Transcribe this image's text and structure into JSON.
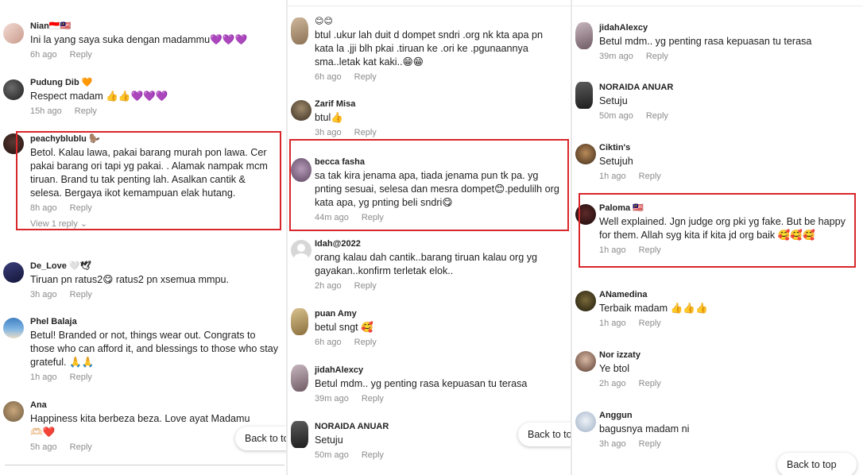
{
  "back_to_top": "Back to top",
  "columns": [
    {
      "comments": [
        {
          "name": "Nian🇮🇩🇲🇾",
          "text": "Ini la yang saya suka dengan madammu💜💜💜",
          "time": "6h ago",
          "reply": "Reply"
        },
        {
          "name": "Pudung Dib 🧡",
          "text": "Respect madam 👍👍💜💜💜",
          "time": "15h ago",
          "reply": "Reply"
        },
        {
          "name": "peachyblublu 🦫",
          "text": "Betol. Kalau lawa, pakai barang murah pon lawa. Cer pakai barang ori tapi yg pakai. . Alamak nampak mcm tiruan. Brand tu tak penting lah. Asalkan cantik & selesa. Bergaya ikot kemampuan elak hutang.",
          "time": "8h ago",
          "reply": "Reply",
          "view_replies": "View 1 reply ⌄"
        },
        {
          "name": "De_Love 🤍🕊",
          "text": "Tiruan pn ratus2😋 ratus2 pn xsemua mmpu.",
          "time": "3h ago",
          "reply": "Reply"
        },
        {
          "name": "Phel Balaja",
          "text": "Betul! Branded or not, things wear out. Congrats to those who can afford it, and blessings to those who stay grateful. 🙏🙏",
          "time": "1h ago",
          "reply": "Reply"
        },
        {
          "name": "Ana",
          "text": "Happiness kita berbeza beza. Love ayat Madamu 🫶🏻❤️",
          "time": "5h ago",
          "reply": "Reply"
        }
      ]
    },
    {
      "comments": [
        {
          "name": "😊😊",
          "text": "btul .ukur lah duit d dompet sndri .org nk kta apa pn kata la .jji blh pkai .tiruan ke .ori ke .pgunaannya sma..letak kat kaki..😁😁",
          "time": "6h ago",
          "reply": "Reply"
        },
        {
          "name": "Zarif Misa",
          "text": "btul👍",
          "time": "3h ago",
          "reply": "Reply"
        },
        {
          "name": "becca fasha",
          "text": "sa tak kira jenama apa, tiada jenama pun tk pa. yg pnting sesuai, selesa dan mesra dompet😊.pedulilh org kata apa, yg pnting beli sndri😋",
          "time": "44m ago",
          "reply": "Reply"
        },
        {
          "name": "Idah@2022",
          "text": "orang kalau dah cantik..barang tiruan kalau org yg gayakan..konfirm terletak elok..",
          "time": "2h ago",
          "reply": "Reply"
        },
        {
          "name": "puan Amy",
          "text": "betul sngt 🥰",
          "time": "6h ago",
          "reply": "Reply"
        },
        {
          "name": "jidahAlexcy",
          "text": "Betul mdm.. yg penting rasa kepuasan tu terasa",
          "time": "39m ago",
          "reply": "Reply"
        },
        {
          "name": "NORAIDA ANUAR",
          "text": "Setuju",
          "time": "50m ago",
          "reply": "Reply"
        }
      ]
    },
    {
      "comments": [
        {
          "name": "jidahAlexcy",
          "text": "Betul mdm.. yg penting rasa kepuasan tu terasa",
          "time": "39m ago",
          "reply": "Reply"
        },
        {
          "name": "NORAIDA ANUAR",
          "text": "Setuju",
          "time": "50m ago",
          "reply": "Reply"
        },
        {
          "name": "Ciktin's",
          "text": "Setujuh",
          "time": "1h ago",
          "reply": "Reply"
        },
        {
          "name": "Paloma 🇲🇾",
          "text": "Well explained. Jgn judge org pki yg fake. But be happy for them. Allah syg kita if kita jd org baik 🥰🥰🥰",
          "time": "1h ago",
          "reply": "Reply"
        },
        {
          "name": "ANamedina",
          "text": "Terbaik madam 👍👍👍",
          "time": "1h ago",
          "reply": "Reply"
        },
        {
          "name": "Nor izzaty",
          "text": "Ye btol",
          "time": "2h ago",
          "reply": "Reply"
        },
        {
          "name": "Anggun",
          "text": "bagusnya madam ni",
          "time": "3h ago",
          "reply": "Reply"
        }
      ]
    }
  ]
}
